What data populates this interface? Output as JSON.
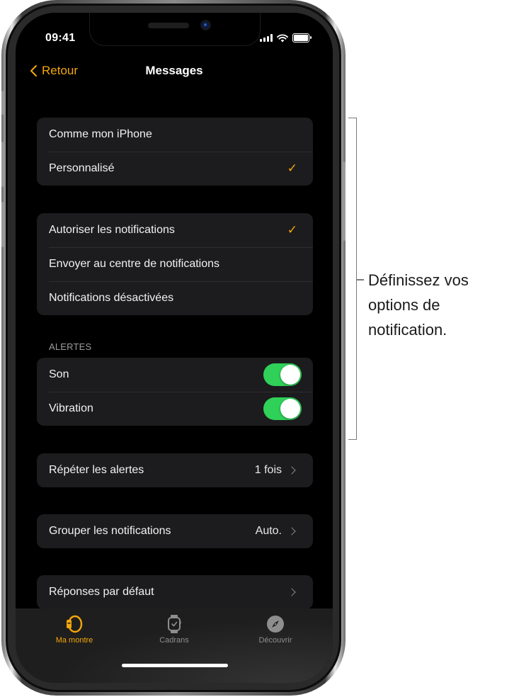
{
  "status_bar": {
    "time": "09:41"
  },
  "nav": {
    "back_label": "Retour",
    "title": "Messages"
  },
  "mirror_group": {
    "items": [
      {
        "label": "Comme mon iPhone",
        "selected": false
      },
      {
        "label": "Personnalisé",
        "selected": true
      }
    ]
  },
  "notifications_group": {
    "items": [
      {
        "label": "Autoriser les notifications",
        "selected": true
      },
      {
        "label": "Envoyer au centre de notifications",
        "selected": false
      },
      {
        "label": "Notifications désactivées",
        "selected": false
      }
    ]
  },
  "alerts": {
    "header": "ALERTES",
    "items": [
      {
        "label": "Son",
        "on": true
      },
      {
        "label": "Vibration",
        "on": true
      }
    ]
  },
  "repeat_alerts": {
    "label": "Répéter les alertes",
    "value": "1 fois"
  },
  "group_notifications": {
    "label": "Grouper les notifications",
    "value": "Auto."
  },
  "default_replies": {
    "label": "Réponses par défaut"
  },
  "check_glyph": "✓",
  "tabbar": {
    "tabs": [
      {
        "label": "Ma montre",
        "icon": "watch-icon",
        "active": true
      },
      {
        "label": "Cadrans",
        "icon": "watch-face-icon",
        "active": false
      },
      {
        "label": "Découvrir",
        "icon": "compass-icon",
        "active": false
      }
    ]
  },
  "callout": {
    "text": "Définissez vos options de notification."
  },
  "colors": {
    "accent": "#f5a70a",
    "toggle_on": "#30d158",
    "cell_bg": "#1c1c1e",
    "screen_bg": "#000000"
  }
}
